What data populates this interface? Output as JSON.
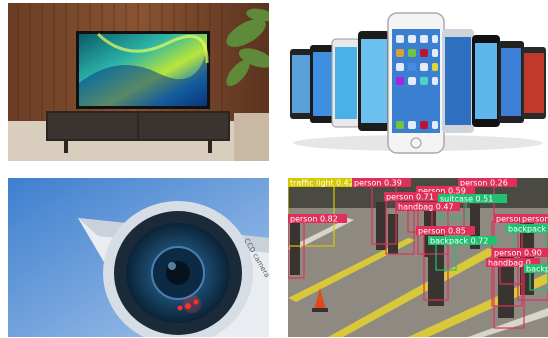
{
  "panels": [
    {
      "id": "tv",
      "icon": "television-photo"
    },
    {
      "id": "phones",
      "icon": "smartphones-photo"
    },
    {
      "id": "cctv",
      "icon": "security-camera-photo"
    },
    {
      "id": "street",
      "icon": "object-detection-photo"
    }
  ],
  "cctv": {
    "camera_text": "CCD camera"
  },
  "detections": [
    {
      "label": "traffic light 0.81",
      "color": "#d8c800"
    },
    {
      "label": "0.42",
      "color": "#d8c800"
    },
    {
      "label": "person 0.39",
      "color": "#e0305a"
    },
    {
      "label": "person 0.26",
      "color": "#e0305a"
    },
    {
      "label": "person 0.59",
      "color": "#e0305a"
    },
    {
      "label": "person 0.71",
      "color": "#e0305a"
    },
    {
      "label": "suitcase 0.51",
      "color": "#20c070"
    },
    {
      "label": "handbag 0.47",
      "color": "#e0305a"
    },
    {
      "label": "person 0.82",
      "color": "#e0305a"
    },
    {
      "label": "person",
      "color": "#e0305a"
    },
    {
      "label": "person 0.",
      "color": "#e0305a"
    },
    {
      "label": "backpack",
      "color": "#20c070"
    },
    {
      "label": "person 0.85",
      "color": "#e0305a"
    },
    {
      "label": "backpack 0.72",
      "color": "#20c070"
    },
    {
      "label": "person 0.90",
      "color": "#e0305a"
    },
    {
      "label": "handbag 0.",
      "color": "#e0305a"
    },
    {
      "label": "backp",
      "color": "#20c070"
    }
  ]
}
